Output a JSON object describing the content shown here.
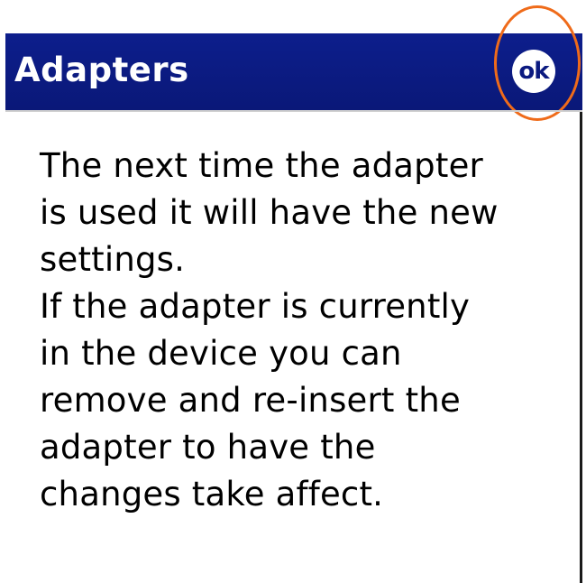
{
  "window": {
    "title": "Adapters",
    "ok_label": "ok"
  },
  "message": {
    "lines": [
      "The next time the adapter",
      "is used it will have the new",
      "settings.",
      "If the adapter is currently",
      "in the device you can",
      "remove and re-insert the",
      "adapter to have the",
      "changes take affect."
    ]
  },
  "colors": {
    "titlebar": "#0b1a80",
    "title_text": "#ffffff",
    "highlight_ring": "#ef6b1a",
    "body_background": "#ffffff",
    "body_text": "#000000"
  }
}
